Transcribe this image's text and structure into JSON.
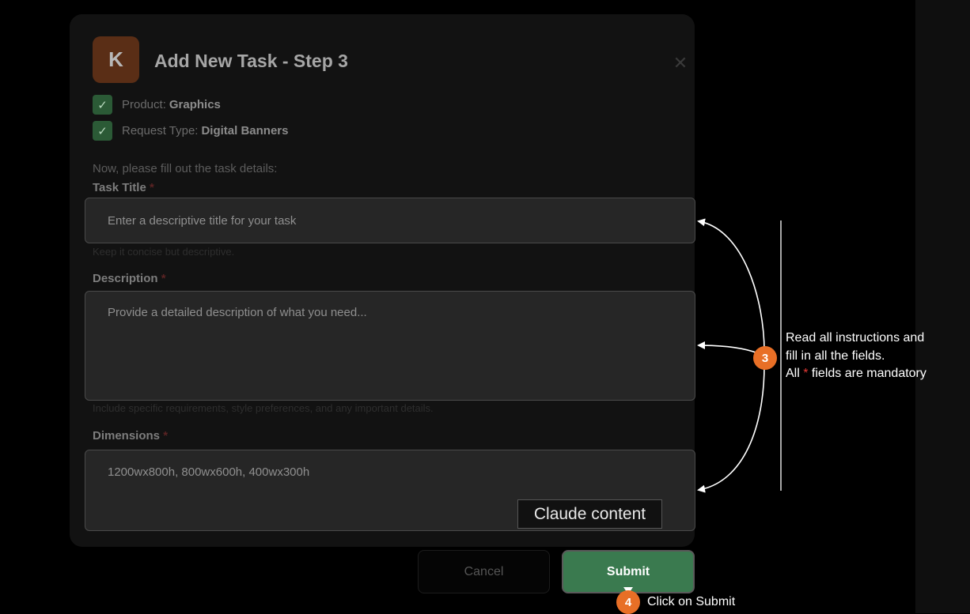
{
  "dialog": {
    "logo_letter": "K",
    "title": "Add New Task - Step 3",
    "close_symbol": "✕"
  },
  "summary": [
    {
      "label": "Product:",
      "value": "Graphics",
      "check_symbol": "✓"
    },
    {
      "label": "Request Type:",
      "value": "Digital Banners",
      "check_symbol": "✓"
    }
  ],
  "intro_text": "Now, please fill out the task details:",
  "required_marker": "*",
  "fields": {
    "task_title": {
      "label": "Task Title",
      "placeholder": "Enter a descriptive title for your task",
      "help": "Keep it concise but descriptive."
    },
    "description": {
      "label": "Description",
      "placeholder": "Provide a detailed description of what you need...",
      "help": "Include specific requirements, style preferences, and any important details."
    },
    "dimensions": {
      "label": "Dimensions",
      "placeholder": "1200wx800h, 800wx600h, 400wx300h"
    }
  },
  "tooltip": "Claude content",
  "buttons": {
    "cancel": "Cancel",
    "submit": "Submit"
  },
  "annotations": {
    "step3": {
      "number": "3",
      "line1": "Read all instructions and",
      "line2": "fill in all the fields.",
      "line3_prefix": "All",
      "line3_star": "*",
      "line3_suffix": "fields are mandatory"
    },
    "step4": {
      "number": "4",
      "text": "Click on Submit"
    }
  },
  "colors": {
    "accent_orange": "#e86f26",
    "submit_green": "#3a7a4f",
    "required_red": "#e53935"
  }
}
